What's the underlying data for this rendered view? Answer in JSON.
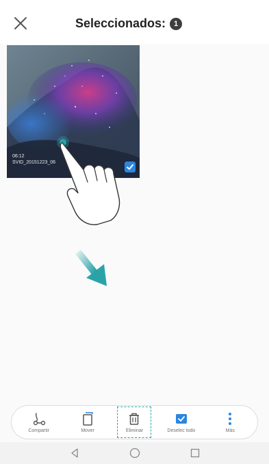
{
  "header": {
    "title": "Seleccionados:",
    "selected_count": "1"
  },
  "photo": {
    "time": "06:12",
    "filename": "SVID_20151223_06"
  },
  "toolbar": {
    "items": [
      {
        "label": "Compartir",
        "icon": "share-icon"
      },
      {
        "label": "Mover",
        "icon": "move-icon"
      },
      {
        "label": "Eliminar",
        "icon": "trash-icon"
      },
      {
        "label": "Deselec todo",
        "icon": "deselect-all-icon"
      },
      {
        "label": "Más",
        "icon": "more-icon"
      }
    ]
  },
  "colors": {
    "accent": "#2a86e0",
    "highlight": "#2aa3a8"
  }
}
